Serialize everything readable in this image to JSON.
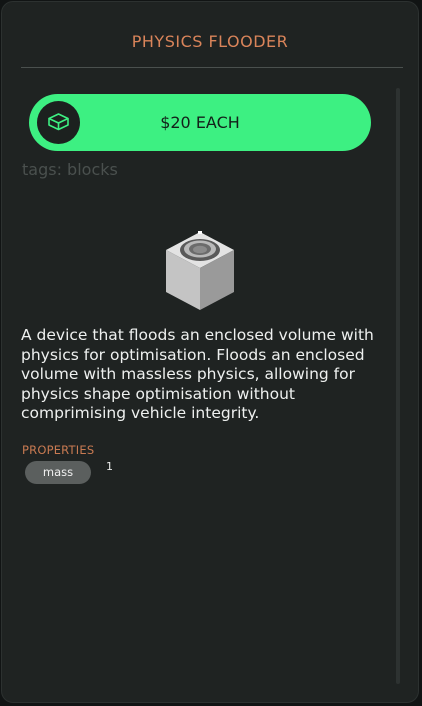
{
  "panel": {
    "title": "PHYSICS FLOODER"
  },
  "buy": {
    "label": "$20 EACH",
    "icon": "block-icon",
    "accent_color": "#3df082"
  },
  "tags": {
    "text": "tags: blocks"
  },
  "product": {
    "image_icon": "physics-flooder-block"
  },
  "description": {
    "text": "A device that floods an enclosed volume with physics for optimisation. Floods an enclosed volume with massless physics, allowing for physics shape optimisation without comprimising vehicle integrity."
  },
  "properties": {
    "heading": "PROPERTIES",
    "items": [
      {
        "name": "mass",
        "value": "1"
      }
    ]
  },
  "colors": {
    "title": "#d9845a",
    "background": "#1f2322"
  }
}
